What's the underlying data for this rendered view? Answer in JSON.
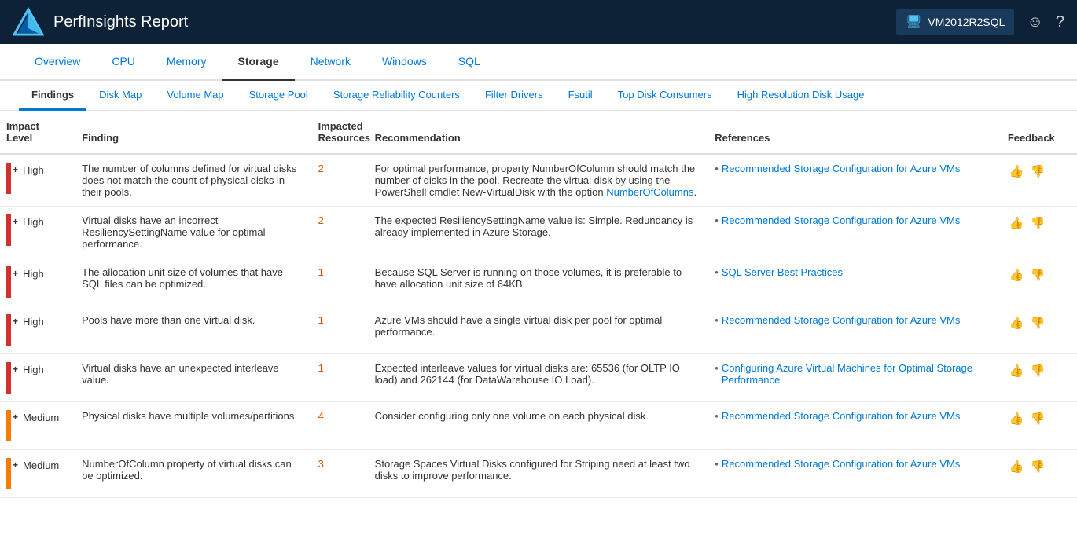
{
  "header": {
    "title": "PerfInsights Report",
    "vm_name": "VM2012R2SQL",
    "smile_icon": "☺",
    "help_icon": "?"
  },
  "main_tabs": [
    {
      "id": "overview",
      "label": "Overview",
      "active": false
    },
    {
      "id": "cpu",
      "label": "CPU",
      "active": false
    },
    {
      "id": "memory",
      "label": "Memory",
      "active": false
    },
    {
      "id": "storage",
      "label": "Storage",
      "active": true
    },
    {
      "id": "network",
      "label": "Network",
      "active": false
    },
    {
      "id": "windows",
      "label": "Windows",
      "active": false
    },
    {
      "id": "sql",
      "label": "SQL",
      "active": false
    }
  ],
  "sub_tabs": [
    {
      "id": "findings",
      "label": "Findings",
      "active": true
    },
    {
      "id": "disk-map",
      "label": "Disk Map",
      "active": false
    },
    {
      "id": "volume-map",
      "label": "Volume Map",
      "active": false
    },
    {
      "id": "storage-pool",
      "label": "Storage Pool",
      "active": false
    },
    {
      "id": "storage-reliability",
      "label": "Storage Reliability Counters",
      "active": false
    },
    {
      "id": "filter-drivers",
      "label": "Filter Drivers",
      "active": false
    },
    {
      "id": "fsutil",
      "label": "Fsutil",
      "active": false
    },
    {
      "id": "top-disk",
      "label": "Top Disk Consumers",
      "active": false
    },
    {
      "id": "high-res-disk",
      "label": "High Resolution Disk Usage",
      "active": false
    }
  ],
  "table": {
    "columns": [
      {
        "id": "impact",
        "label": "Impact\nLevel"
      },
      {
        "id": "finding",
        "label": "Finding"
      },
      {
        "id": "impacted",
        "label": "Impacted\nResources"
      },
      {
        "id": "recommendation",
        "label": "Recommendation"
      },
      {
        "id": "references",
        "label": "References"
      },
      {
        "id": "feedback",
        "label": "Feedback"
      }
    ],
    "rows": [
      {
        "impact": "High",
        "impact_class": "high",
        "finding": "The number of columns defined for virtual disks does not match the count of physical disks in their pools.",
        "impacted": "2",
        "recommendation": "For optimal performance, property NumberOfColumn should match the number of disks in the pool. Recreate the virtual disk by using the PowerShell cmdlet New-VirtualDisk with the option NumberOfColumns.",
        "recommendation_highlight": "NumberOfColumns",
        "references": [
          {
            "text": "Recommended Storage Configuration for Azure VMs",
            "url": "#"
          }
        ]
      },
      {
        "impact": "High",
        "impact_class": "high",
        "finding": "Virtual disks have an incorrect ResiliencySettingName value for optimal performance.",
        "impacted": "2",
        "recommendation": "The expected ResiliencySettingName value is: Simple. Redundancy is already implemented in Azure Storage.",
        "recommendation_highlight": "",
        "references": [
          {
            "text": "Recommended Storage Configuration for Azure VMs",
            "url": "#"
          }
        ]
      },
      {
        "impact": "High",
        "impact_class": "high",
        "finding": "The allocation unit size of volumes that have SQL files can be optimized.",
        "impacted": "1",
        "recommendation": "Because SQL Server is running on those volumes, it is preferable to have allocation unit size of 64KB.",
        "recommendation_highlight": "",
        "references": [
          {
            "text": "SQL Server Best Practices",
            "url": "#"
          }
        ]
      },
      {
        "impact": "High",
        "impact_class": "high",
        "finding": "Pools have more than one virtual disk.",
        "impacted": "1",
        "recommendation": "Azure VMs should have a single virtual disk per pool for optimal performance.",
        "recommendation_highlight": "",
        "references": [
          {
            "text": "Recommended Storage Configuration for Azure VMs",
            "url": "#"
          }
        ]
      },
      {
        "impact": "High",
        "impact_class": "high",
        "finding": "Virtual disks have an unexpected interleave value.",
        "impacted": "1",
        "recommendation": "Expected interleave values for virtual disks are: 65536 (for OLTP IO load) and 262144 (for DataWarehouse IO Load).",
        "recommendation_highlight": "",
        "references": [
          {
            "text": "Configuring Azure Virtual Machines for Optimal Storage Performance",
            "url": "#"
          }
        ]
      },
      {
        "impact": "Medium",
        "impact_class": "medium",
        "finding": "Physical disks have multiple volumes/partitions.",
        "impacted": "4",
        "recommendation": "Consider configuring only one volume on each physical disk.",
        "recommendation_highlight": "",
        "references": [
          {
            "text": "Recommended Storage Configuration for Azure VMs",
            "url": "#"
          }
        ]
      },
      {
        "impact": "Medium",
        "impact_class": "medium",
        "finding": "NumberOfColumn property of virtual disks can be optimized.",
        "impacted": "3",
        "recommendation": "Storage Spaces Virtual Disks configured for Striping need at least two disks to improve performance.",
        "recommendation_highlight": "",
        "references": [
          {
            "text": "Recommended Storage Configuration for Azure VMs",
            "url": "#"
          }
        ]
      }
    ]
  }
}
